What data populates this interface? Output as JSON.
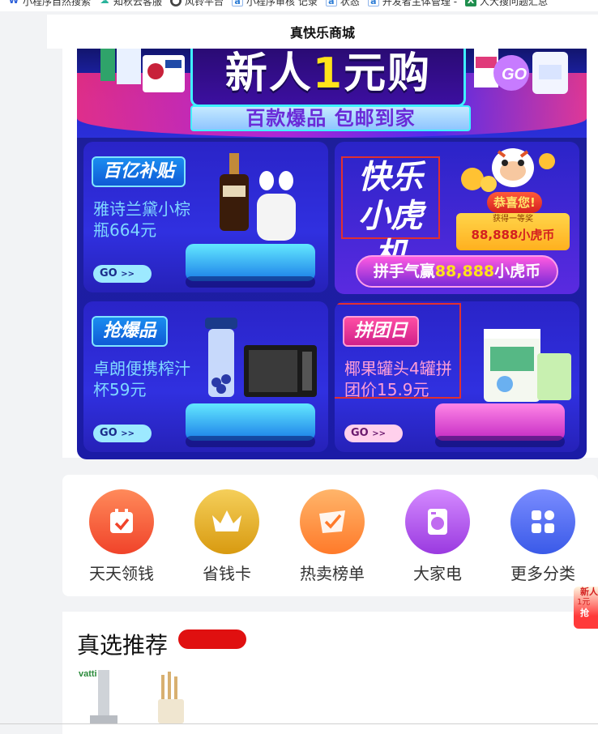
{
  "bookmarks": [
    {
      "icon": "word-icon",
      "glyph": "W",
      "label": "小程序自然搜索"
    },
    {
      "icon": "cloud-icon",
      "glyph": "☁",
      "label": "知秋云客服"
    },
    {
      "icon": "fengling-icon",
      "glyph": "●",
      "label": "风铃平台"
    },
    {
      "icon": "page-icon",
      "glyph": "a",
      "label": "小程序审核 记录"
    },
    {
      "icon": "page-icon",
      "glyph": "a",
      "label": "状态"
    },
    {
      "icon": "page-icon",
      "glyph": "a",
      "label": "开发者主体管理 -"
    },
    {
      "icon": "excel-icon",
      "glyph": "X",
      "label": "人大搜问题汇总"
    }
  ],
  "header": {
    "title": "真快乐商城"
  },
  "banner": {
    "hero_title_a": "新人",
    "hero_title_one": "1",
    "hero_title_b": "元购",
    "hero_sub": "百款爆品 包邮到家",
    "hero_go": "GO"
  },
  "cards": [
    {
      "tag": "百亿补贴",
      "desc": "雅诗兰黛小棕瓶664元",
      "go": "GO",
      "arrow": ">>"
    },
    {
      "title_line1": "快乐",
      "title_line2": "小虎机",
      "congrats": "恭喜您!",
      "prize_small": "获得一等奖",
      "prize_big": "88,888小虎币",
      "coin_prefix": "拼手气赢",
      "coin_value": "88,888",
      "coin_suffix": "小虎币"
    },
    {
      "tag": "抢爆品",
      "desc": "卓朗便携榨汁杯59元",
      "go": "GO",
      "arrow": ">>"
    },
    {
      "tag": "拼团日",
      "desc": "椰果罐头4罐拼团价15.9元",
      "go": "GO",
      "arrow": ">>"
    }
  ],
  "categories": [
    {
      "label": "天天领钱",
      "icon": "calendar-check-icon",
      "color": "#f05a3a"
    },
    {
      "label": "省钱卡",
      "icon": "crown-icon",
      "color": "#e6b12a"
    },
    {
      "label": "热卖榜单",
      "icon": "flag-check-icon",
      "color": "#ff8a3a"
    },
    {
      "label": "大家电",
      "icon": "washer-icon",
      "color": "#b25ce8"
    },
    {
      "label": "更多分类",
      "icon": "grid-icon",
      "color": "#4a6cf0"
    }
  ],
  "recommend": {
    "title": "真选推荐"
  },
  "float_promo": {
    "line1": "新人",
    "line2": "1元",
    "line3": "抢"
  }
}
